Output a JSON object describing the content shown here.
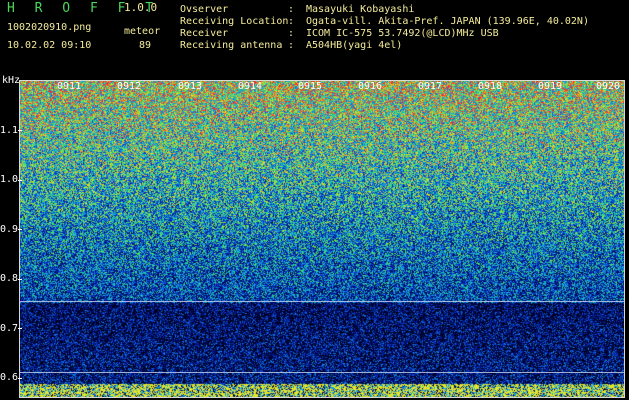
{
  "header": {
    "app_title": "H R O F F T",
    "version": "1.0.0",
    "filename": "1002020910.png",
    "meteor_label": "meteor",
    "datetime": "10.02.02 09:10",
    "meteor_count": "89"
  },
  "station_info": [
    {
      "label": "Ovserver",
      "sep": ":",
      "value": "Masayuki Kobayashi"
    },
    {
      "label": "Receiving Location",
      "sep": ":",
      "value": "Ogata-vill. Akita-Pref. JAPAN (139.96E, 40.02N)"
    },
    {
      "label": "Receiver",
      "sep": ":",
      "value": "ICOM IC-575 53.7492(@LCD)MHz USB"
    },
    {
      "label": "Receiving antenna",
      "sep": ":",
      "value": "A504HB(yagi 4el)"
    }
  ],
  "y_axis": {
    "unit": "kHz",
    "ticks": [
      "1.1",
      "1.0",
      "0.9",
      "0.8",
      "0.7",
      "0.6"
    ]
  },
  "x_axis": {
    "ticks": [
      "0911",
      "0912",
      "0913",
      "0914",
      "0915",
      "0916",
      "0917",
      "0918",
      "0919",
      "0920"
    ]
  },
  "colors": {
    "title_green": "#4cd65c",
    "text_yellow": "#f4ec9a",
    "background": "#000000"
  }
}
